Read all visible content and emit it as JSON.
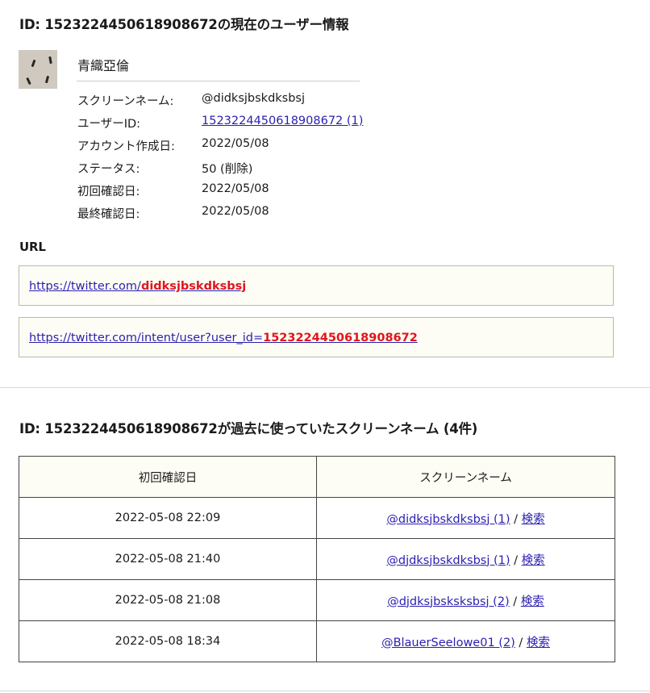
{
  "current": {
    "heading": "ID: 1523224450618908672の現在のユーザー情報",
    "display_name": "青織亞倫",
    "fields": [
      {
        "label": "スクリーンネーム:",
        "value": "@didksjbskdksbsj"
      },
      {
        "label": "ユーザーID:",
        "value": "1523224450618908672 (1)"
      },
      {
        "label": "アカウント作成日:",
        "value": "2022/05/08"
      },
      {
        "label": "ステータス:",
        "value": "50 (削除)"
      },
      {
        "label": "初回確認日:",
        "value": "2022/05/08"
      },
      {
        "label": "最終確認日:",
        "value": "2022/05/08"
      }
    ]
  },
  "url": {
    "label": "URL",
    "links": [
      {
        "prefix": "https://twitter.com/",
        "highlight": "didksjbskdksbsj"
      },
      {
        "prefix": "https://twitter.com/intent/user?user_id=",
        "highlight": "1523224450618908672"
      }
    ]
  },
  "history": {
    "heading": "ID: 1523224450618908672が過去に使っていたスクリーンネーム (4件)",
    "columns": [
      "初回確認日",
      "スクリーンネーム"
    ],
    "separator": " / ",
    "rows": [
      {
        "date": "2022-05-08 22:09",
        "screen_name": "@didksjbskdksbsj (1)",
        "search": "検索"
      },
      {
        "date": "2022-05-08 21:40",
        "screen_name": "@djdksjbskdksbsj (1)",
        "search": "検索"
      },
      {
        "date": "2022-05-08 21:08",
        "screen_name": "@djdksjbsksksbsj (2)",
        "search": "検索"
      },
      {
        "date": "2022-05-08 18:34",
        "screen_name": "@BlauerSeelowe01 (2)",
        "search": "検索"
      }
    ]
  },
  "colors": {
    "link": "#2a1fb0",
    "highlight": "#e0151d",
    "box_background": "#fdfdf5"
  }
}
